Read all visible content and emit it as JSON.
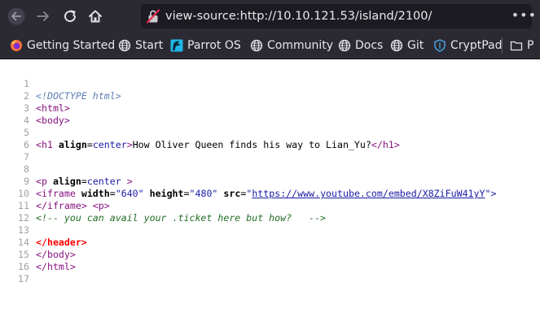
{
  "browser": {
    "url": "view-source:http://10.10.121.53/island/2100/",
    "more_menu": "•••",
    "icons": {
      "back": "arrow-left-icon",
      "forward": "arrow-right-icon",
      "reload": "reload-icon",
      "home": "home-icon",
      "security": "broken-lock-icon"
    }
  },
  "bookmarks": [
    {
      "label": "Getting Started",
      "icon": "firefox-icon"
    },
    {
      "label": "Start",
      "icon": "globe-icon"
    },
    {
      "label": "Parrot OS",
      "icon": "parrot-icon"
    },
    {
      "label": "Community",
      "icon": "globe-icon"
    },
    {
      "label": "Docs",
      "icon": "globe-icon"
    },
    {
      "label": "Git",
      "icon": "globe-icon"
    },
    {
      "label": "CryptPad",
      "icon": "shield-icon"
    },
    {
      "label": "P",
      "icon": "folder-icon"
    }
  ],
  "source": {
    "line_numbers": [
      "1",
      "2",
      "3",
      "4",
      "5",
      "6",
      "7",
      "8",
      "9",
      "10",
      "11",
      "12",
      "13",
      "14",
      "15",
      "16",
      "17"
    ],
    "l1": "<!DOCTYPE html>",
    "l2": "<html>",
    "l3": "<body>",
    "l5_open": "<h1 ",
    "l5_attr": "align",
    "l5_eq": "=",
    "l5_val": "center",
    "l5_gt": ">",
    "l5_text": "How Oliver Queen finds his way to Lian_Yu?",
    "l5_close": "</h1>",
    "l8_open": "<p ",
    "l8_attr": "align",
    "l8_eq": "=",
    "l8_val": "center",
    "l8_gt": " >",
    "l9_open": "<iframe ",
    "l9_attr1": "width",
    "l9_val1": "\"640\"",
    "l9_attr2": "height",
    "l9_val2": "\"480\"",
    "l9_attr3": "src",
    "l9_q1": "\"",
    "l9_link": "https://www.youtube.com/embed/X8ZiFuW41yY",
    "l9_end": "\">",
    "l10_a": "</iframe>",
    "l10_b": "<p>",
    "l11": "<!-- you can avail your .ticket here but how?   -->",
    "l13": "</header>",
    "l14": "</body>",
    "l15": "</html>"
  }
}
